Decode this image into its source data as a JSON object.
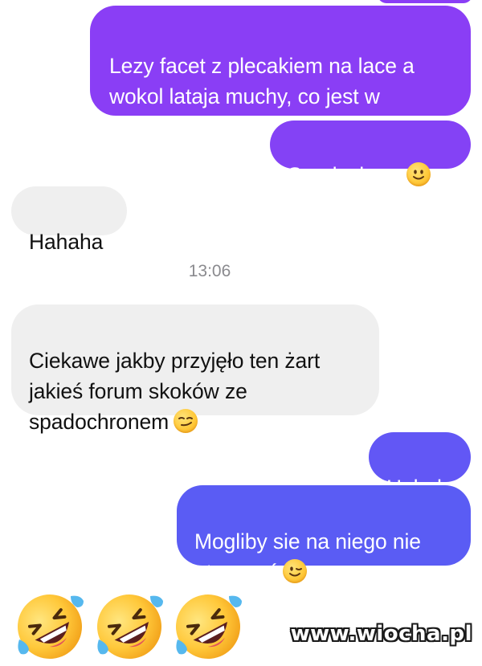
{
  "colors": {
    "outgoing_top": "#8a3ef5",
    "outgoing_mid": "#7a4cf6",
    "outgoing_bottom": "#5b5cf4",
    "incoming": "#efefef",
    "timestamp": "#8a8a8e"
  },
  "messages": [
    {
      "direction": "outgoing",
      "text": "Lezy facet z plecakiem na lace a\nwokol lataja muchy, co jest w\nplecaku?"
    },
    {
      "direction": "outgoing",
      "text": "Spadochron",
      "emoji": "slightly-smiling-face-icon"
    },
    {
      "direction": "incoming",
      "text": "Hahaha"
    },
    {
      "direction": "incoming",
      "text": "Ciekawe jakby przyjęło ten żart\njakieś forum skoków ze\nspadochronem",
      "emoji": "smirking-face-icon"
    },
    {
      "direction": "outgoing",
      "text": "Hahah"
    },
    {
      "direction": "outgoing",
      "text": "Mogliby sie na niego nie\notworzyć",
      "emoji": "winking-face-icon"
    }
  ],
  "timestamp": "13:06",
  "reaction_emojis": [
    "rolling-on-floor-laughing-icon",
    "rolling-on-floor-laughing-icon",
    "rolling-on-floor-laughing-icon"
  ],
  "watermark": "www.wiocha.pl"
}
